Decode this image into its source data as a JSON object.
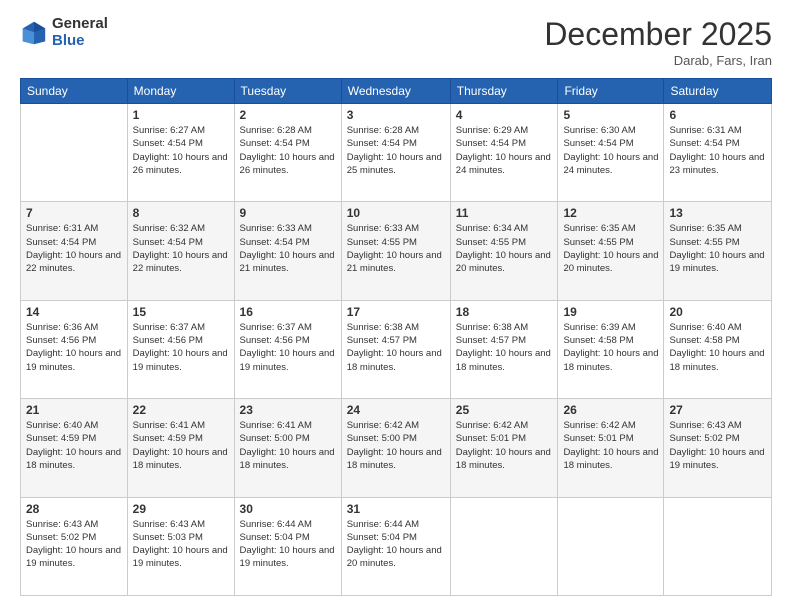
{
  "logo": {
    "general": "General",
    "blue": "Blue"
  },
  "header": {
    "month": "December 2025",
    "location": "Darab, Fars, Iran"
  },
  "weekdays": [
    "Sunday",
    "Monday",
    "Tuesday",
    "Wednesday",
    "Thursday",
    "Friday",
    "Saturday"
  ],
  "weeks": [
    [
      {
        "day": "",
        "info": ""
      },
      {
        "day": "1",
        "info": "Sunrise: 6:27 AM\nSunset: 4:54 PM\nDaylight: 10 hours and 26 minutes."
      },
      {
        "day": "2",
        "info": "Sunrise: 6:28 AM\nSunset: 4:54 PM\nDaylight: 10 hours and 26 minutes."
      },
      {
        "day": "3",
        "info": "Sunrise: 6:28 AM\nSunset: 4:54 PM\nDaylight: 10 hours and 25 minutes."
      },
      {
        "day": "4",
        "info": "Sunrise: 6:29 AM\nSunset: 4:54 PM\nDaylight: 10 hours and 24 minutes."
      },
      {
        "day": "5",
        "info": "Sunrise: 6:30 AM\nSunset: 4:54 PM\nDaylight: 10 hours and 24 minutes."
      },
      {
        "day": "6",
        "info": "Sunrise: 6:31 AM\nSunset: 4:54 PM\nDaylight: 10 hours and 23 minutes."
      }
    ],
    [
      {
        "day": "7",
        "info": "Sunrise: 6:31 AM\nSunset: 4:54 PM\nDaylight: 10 hours and 22 minutes."
      },
      {
        "day": "8",
        "info": "Sunrise: 6:32 AM\nSunset: 4:54 PM\nDaylight: 10 hours and 22 minutes."
      },
      {
        "day": "9",
        "info": "Sunrise: 6:33 AM\nSunset: 4:54 PM\nDaylight: 10 hours and 21 minutes."
      },
      {
        "day": "10",
        "info": "Sunrise: 6:33 AM\nSunset: 4:55 PM\nDaylight: 10 hours and 21 minutes."
      },
      {
        "day": "11",
        "info": "Sunrise: 6:34 AM\nSunset: 4:55 PM\nDaylight: 10 hours and 20 minutes."
      },
      {
        "day": "12",
        "info": "Sunrise: 6:35 AM\nSunset: 4:55 PM\nDaylight: 10 hours and 20 minutes."
      },
      {
        "day": "13",
        "info": "Sunrise: 6:35 AM\nSunset: 4:55 PM\nDaylight: 10 hours and 19 minutes."
      }
    ],
    [
      {
        "day": "14",
        "info": "Sunrise: 6:36 AM\nSunset: 4:56 PM\nDaylight: 10 hours and 19 minutes."
      },
      {
        "day": "15",
        "info": "Sunrise: 6:37 AM\nSunset: 4:56 PM\nDaylight: 10 hours and 19 minutes."
      },
      {
        "day": "16",
        "info": "Sunrise: 6:37 AM\nSunset: 4:56 PM\nDaylight: 10 hours and 19 minutes."
      },
      {
        "day": "17",
        "info": "Sunrise: 6:38 AM\nSunset: 4:57 PM\nDaylight: 10 hours and 18 minutes."
      },
      {
        "day": "18",
        "info": "Sunrise: 6:38 AM\nSunset: 4:57 PM\nDaylight: 10 hours and 18 minutes."
      },
      {
        "day": "19",
        "info": "Sunrise: 6:39 AM\nSunset: 4:58 PM\nDaylight: 10 hours and 18 minutes."
      },
      {
        "day": "20",
        "info": "Sunrise: 6:40 AM\nSunset: 4:58 PM\nDaylight: 10 hours and 18 minutes."
      }
    ],
    [
      {
        "day": "21",
        "info": "Sunrise: 6:40 AM\nSunset: 4:59 PM\nDaylight: 10 hours and 18 minutes."
      },
      {
        "day": "22",
        "info": "Sunrise: 6:41 AM\nSunset: 4:59 PM\nDaylight: 10 hours and 18 minutes."
      },
      {
        "day": "23",
        "info": "Sunrise: 6:41 AM\nSunset: 5:00 PM\nDaylight: 10 hours and 18 minutes."
      },
      {
        "day": "24",
        "info": "Sunrise: 6:42 AM\nSunset: 5:00 PM\nDaylight: 10 hours and 18 minutes."
      },
      {
        "day": "25",
        "info": "Sunrise: 6:42 AM\nSunset: 5:01 PM\nDaylight: 10 hours and 18 minutes."
      },
      {
        "day": "26",
        "info": "Sunrise: 6:42 AM\nSunset: 5:01 PM\nDaylight: 10 hours and 18 minutes."
      },
      {
        "day": "27",
        "info": "Sunrise: 6:43 AM\nSunset: 5:02 PM\nDaylight: 10 hours and 19 minutes."
      }
    ],
    [
      {
        "day": "28",
        "info": "Sunrise: 6:43 AM\nSunset: 5:02 PM\nDaylight: 10 hours and 19 minutes."
      },
      {
        "day": "29",
        "info": "Sunrise: 6:43 AM\nSunset: 5:03 PM\nDaylight: 10 hours and 19 minutes."
      },
      {
        "day": "30",
        "info": "Sunrise: 6:44 AM\nSunset: 5:04 PM\nDaylight: 10 hours and 19 minutes."
      },
      {
        "day": "31",
        "info": "Sunrise: 6:44 AM\nSunset: 5:04 PM\nDaylight: 10 hours and 20 minutes."
      },
      {
        "day": "",
        "info": ""
      },
      {
        "day": "",
        "info": ""
      },
      {
        "day": "",
        "info": ""
      }
    ]
  ]
}
